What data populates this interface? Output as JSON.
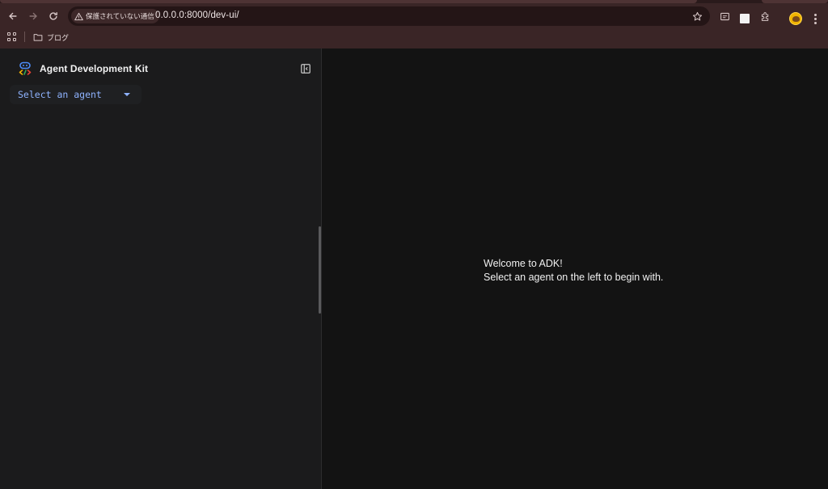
{
  "browser": {
    "security_chip": "保護されていない通信",
    "url": "0.0.0.0:8000/dev-ui/",
    "bookmarks": [
      {
        "label": "ブログ",
        "icon": "folder-icon"
      }
    ],
    "colors": {
      "frame": "#3a2526",
      "omnibox": "#241516"
    }
  },
  "app": {
    "title": "Agent Development Kit",
    "agent_select": {
      "value": "Select an agent"
    },
    "welcome": {
      "line1": "Welcome to ADK!",
      "line2": "Select an agent on the left to begin with."
    },
    "colors": {
      "sidebar_bg": "#1b1b1c",
      "main_bg": "#131313",
      "accent": "#8fb3ff"
    }
  }
}
